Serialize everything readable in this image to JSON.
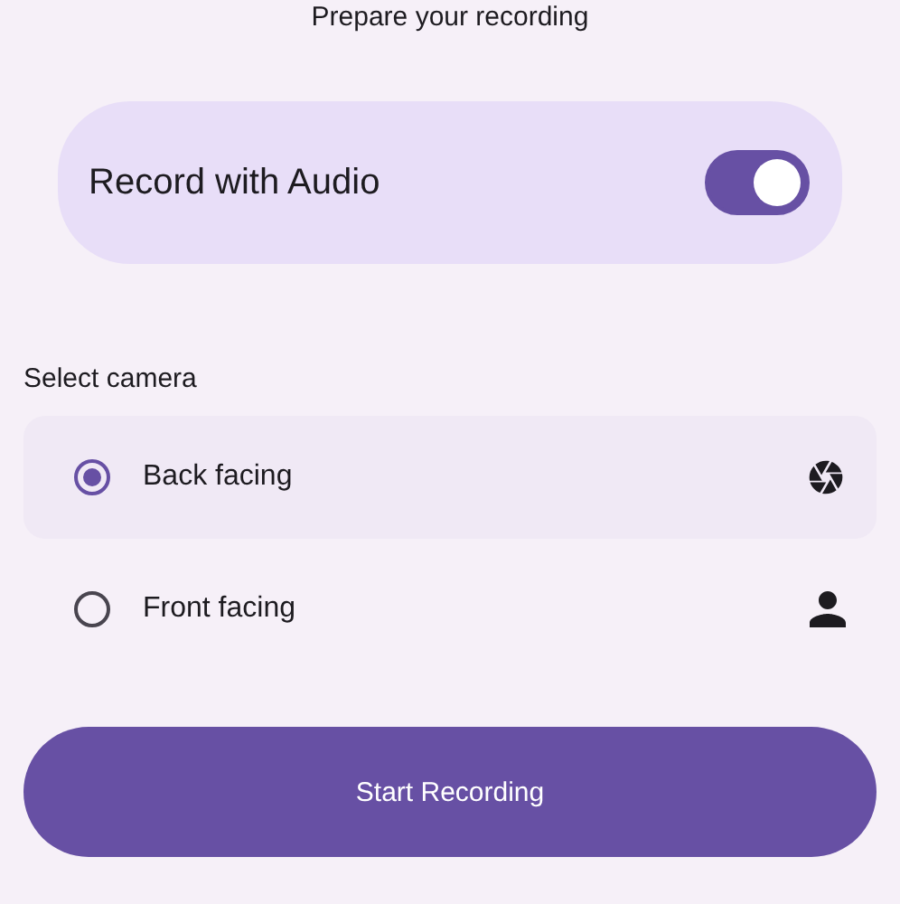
{
  "header": {
    "title": "Prepare your recording"
  },
  "audio": {
    "label": "Record with Audio",
    "on": true
  },
  "camera": {
    "label": "Select camera",
    "options": [
      {
        "label": "Back facing",
        "selected": true,
        "kind": "back"
      },
      {
        "label": "Front facing",
        "selected": false,
        "kind": "front"
      }
    ]
  },
  "button": {
    "label": "Start Recording"
  }
}
